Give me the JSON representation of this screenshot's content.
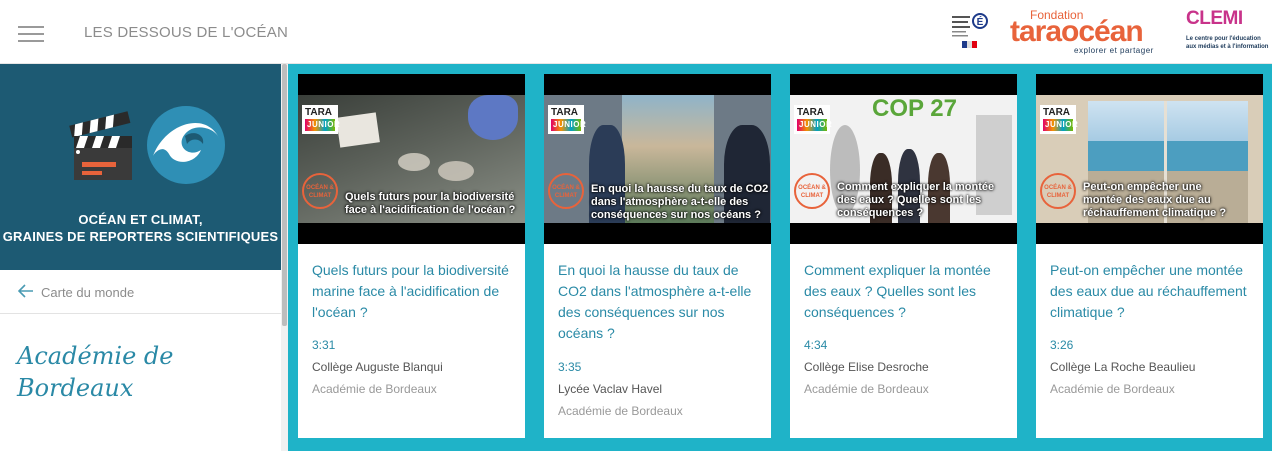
{
  "header": {
    "site_title": "LES DESSOUS DE L'OCÉAN",
    "tara_fondation": "Fondation",
    "tara_name": "taraocéan",
    "tara_tagline": "explorer et partager",
    "clemi_name": "CLEMI",
    "clemi_tagline_1": "Le centre pour l'éducation",
    "clemi_tagline_2": "aux médias et à l'information"
  },
  "sidebar": {
    "banner_title_line1": "OCÉAN ET CLIMAT,",
    "banner_title_line2": "GRAINES DE REPORTERS SCIENTIFIQUES",
    "back_label": "Carte du monde",
    "academy": "Académie de Bordeaux"
  },
  "badge": {
    "tara": "TARA",
    "junior": "JUNIOR",
    "stamp": "OCÉAN & CLIMAT"
  },
  "cards": [
    {
      "overlay": "Quels futurs pour la biodiversité face à l'acidification de l'océan ?",
      "title": "Quels futurs pour la biodiversité marine face à l'acidification de l'océan ?",
      "duration": "3:31",
      "school": "Collège Auguste Blanqui",
      "academy": "Académie de Bordeaux"
    },
    {
      "overlay": "En quoi la hausse du taux de CO2 dans l'atmosphère a-t-elle des conséquences sur nos océans ?",
      "title": "En quoi la hausse du taux de CO2 dans l'atmosphère a-t-elle des conséquences sur nos océans ?",
      "duration": "3:35",
      "school": "Lycée Vaclav Havel",
      "academy": "Académie de Bordeaux"
    },
    {
      "overlay": "Comment expliquer la montée des eaux ? Quelles sont les conséquences ?",
      "title": "Comment expliquer la montée des eaux ? Quelles sont les conséquences ?",
      "duration": "4:34",
      "school": "Collège Elise Desroche",
      "academy": "Académie de Bordeaux",
      "cop": "COP 27"
    },
    {
      "overlay": "Peut-on empêcher une montée des eaux due au réchauffement climatique ?",
      "title": "Peut-on empêcher une montée des eaux due au réchauffement climatique ?",
      "duration": "3:26",
      "school": "Collège La Roche Beaulieu",
      "academy": "Académie de Bordeaux"
    }
  ]
}
